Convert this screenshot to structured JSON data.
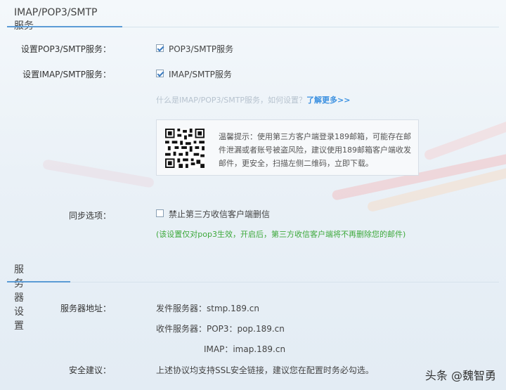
{
  "imap_section": {
    "title": "IMAP/POP3/SMTP服务",
    "pop3_label": "设置POP3/SMTP服务：",
    "pop3_option": "POP3/SMTP服务",
    "imap_label": "设置IMAP/SMTP服务：",
    "imap_option": "IMAP/SMTP服务",
    "help_text": "什么是IMAP/POP3/SMTP服务，如何设置？",
    "help_link": "了解更多>>",
    "tip": "温馨提示：使用第三方客户端登录189邮箱，可能存在邮件泄漏或者账号被盗风险，建议使用189邮箱客户端收发邮件，更安全，扫描左侧二维码，立即下载。",
    "sync_label": "同步选项：",
    "sync_option": "禁止第三方收信客户端删信",
    "sync_note": "(该设置仅对pop3生效，开启后，第三方收信客户端将不再删除您的邮件)"
  },
  "server_section": {
    "title": "服务器设置",
    "address_label": "服务器地址：",
    "send_server": "发件服务器：stmp.189.cn",
    "recv_server": "收件服务器：POP3：pop.189.cn",
    "imap_server": "IMAP：imap.189.cn",
    "security_label": "安全建议：",
    "security_text": "上述协议均支持SSL安全链接，建议您在配置时务必勾选。"
  },
  "watermark": "头条 @魏智勇",
  "colors": {
    "accent": "#5b9bd5",
    "link": "#3b90e0",
    "note_green": "#3da93b"
  }
}
